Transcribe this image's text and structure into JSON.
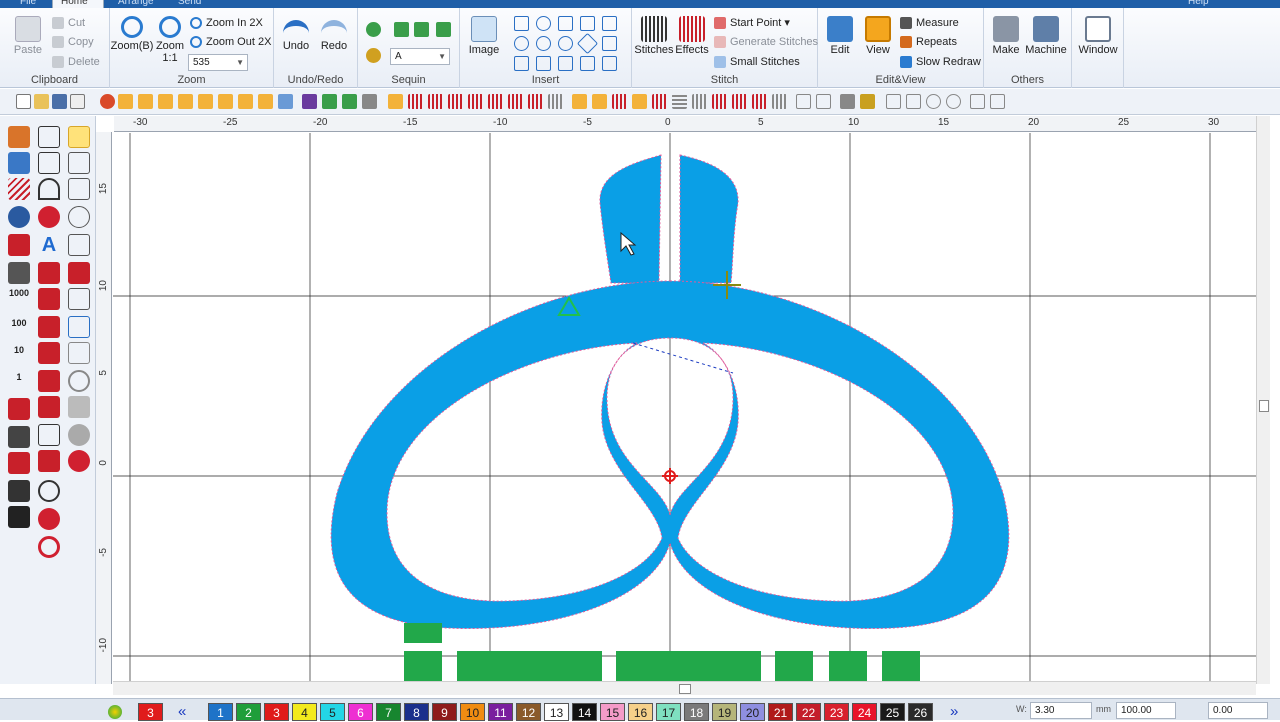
{
  "menu": {
    "tabs": [
      {
        "label": "File",
        "active": false
      },
      {
        "label": "Home",
        "active": true
      },
      {
        "label": "Arrange",
        "active": false
      },
      {
        "label": "Send",
        "active": false
      }
    ],
    "help_label": "Help"
  },
  "ribbon": {
    "clipboard": {
      "label": "Clipboard",
      "paste": "Paste",
      "cut": "Cut",
      "copy": "Copy",
      "delete": "Delete"
    },
    "zoom": {
      "label": "Zoom",
      "zoom_b": "Zoom(B)",
      "zoom_11_a": "Zoom",
      "zoom_11_b": "1:1",
      "zoom_in": "Zoom In 2X",
      "zoom_out": "Zoom Out 2X",
      "value": "535"
    },
    "undoredo": {
      "label": "Undo/Redo",
      "undo": "Undo",
      "redo": "Redo"
    },
    "sequin": {
      "label": "Sequin",
      "value": "A"
    },
    "insert": {
      "label": "Insert",
      "image": "Image"
    },
    "stitch": {
      "label": "Stitch",
      "stitches": "Stitches",
      "effects": "Effects",
      "start_point": "Start Point",
      "generate": "Generate Stitches",
      "small": "Small Stitches"
    },
    "editview": {
      "label": "Edit&View",
      "edit": "Edit",
      "view": "View",
      "measure": "Measure",
      "repeats": "Repeats",
      "slow_redraw": "Slow Redraw"
    },
    "others": {
      "label": "Others",
      "make": "Make",
      "machine": "Machine"
    },
    "window": {
      "label": "Window"
    }
  },
  "left_tools": {
    "n1000": "1000",
    "n100": "100",
    "n10": "10",
    "n1": "1"
  },
  "rulers": {
    "h": [
      "-30",
      "-25",
      "-20",
      "-15",
      "-10",
      "-5",
      "0",
      "5",
      "10",
      "15",
      "20",
      "25",
      "30"
    ],
    "v": [
      "15",
      "10",
      "5",
      "0",
      "-5",
      "-10"
    ]
  },
  "colors": {
    "fill": "#0a9fe6",
    "bar": "#22a84a",
    "accent": "#1f5fa8"
  },
  "palette": [
    {
      "n": "3",
      "bg": "#e01b1b",
      "fg": "#ffffff"
    },
    {
      "n": "1",
      "bg": "#1e73c8",
      "fg": "#ffffff"
    },
    {
      "n": "2",
      "bg": "#1f9e3a",
      "fg": "#ffffff"
    },
    {
      "n": "3",
      "bg": "#e01b1b",
      "fg": "#ffffff"
    },
    {
      "n": "4",
      "bg": "#f3ea1d",
      "fg": "#222222"
    },
    {
      "n": "5",
      "bg": "#23d6e6",
      "fg": "#222222"
    },
    {
      "n": "6",
      "bg": "#ee2fd2",
      "fg": "#ffffff"
    },
    {
      "n": "7",
      "bg": "#17862f",
      "fg": "#ffffff"
    },
    {
      "n": "8",
      "bg": "#1a2f8c",
      "fg": "#ffffff"
    },
    {
      "n": "9",
      "bg": "#8e1b1b",
      "fg": "#ffffff"
    },
    {
      "n": "10",
      "bg": "#f08c12",
      "fg": "#222222"
    },
    {
      "n": "11",
      "bg": "#7a1f9e",
      "fg": "#ffffff"
    },
    {
      "n": "12",
      "bg": "#8a5a2a",
      "fg": "#ffffff"
    },
    {
      "n": "13",
      "bg": "#ffffff",
      "fg": "#222222"
    },
    {
      "n": "14",
      "bg": "#111111",
      "fg": "#ffffff"
    },
    {
      "n": "15",
      "bg": "#f49bc8",
      "fg": "#222222"
    },
    {
      "n": "16",
      "bg": "#f6d08a",
      "fg": "#222222"
    },
    {
      "n": "17",
      "bg": "#7fe0c0",
      "fg": "#222222"
    },
    {
      "n": "18",
      "bg": "#7a7a7a",
      "fg": "#ffffff"
    },
    {
      "n": "19",
      "bg": "#b5b57a",
      "fg": "#222222"
    },
    {
      "n": "20",
      "bg": "#8f8fe0",
      "fg": "#222222"
    },
    {
      "n": "21",
      "bg": "#b01a1a",
      "fg": "#ffffff"
    },
    {
      "n": "22",
      "bg": "#c41d2a",
      "fg": "#ffffff"
    },
    {
      "n": "23",
      "bg": "#d8202e",
      "fg": "#ffffff"
    },
    {
      "n": "24",
      "bg": "#e8132a",
      "fg": "#ffffff"
    },
    {
      "n": "25",
      "bg": "#1a1a1a",
      "fg": "#ffffff"
    },
    {
      "n": "26",
      "bg": "#2a2a2a",
      "fg": "#ffffff"
    }
  ],
  "status": {
    "w_label": "W:",
    "w_value": "3.30",
    "unit": "mm",
    "pct": "100.00",
    "h_value": "0.00"
  }
}
